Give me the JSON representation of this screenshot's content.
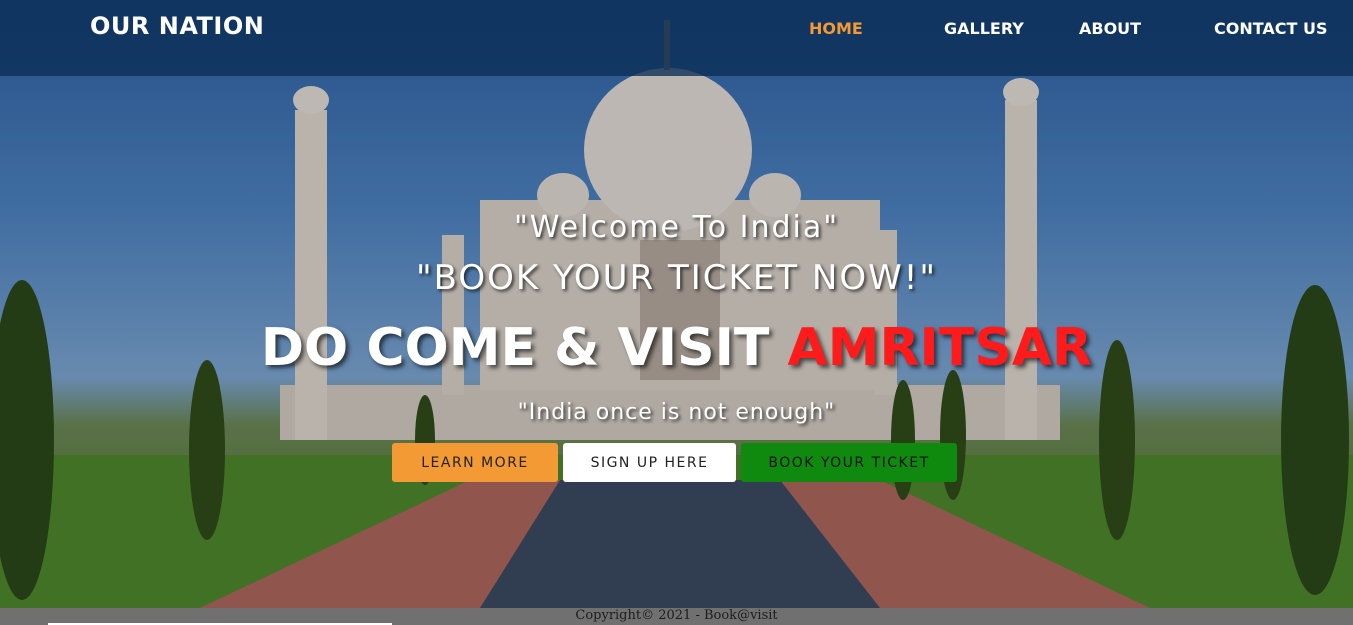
{
  "brand": {
    "name": "OUR NATION"
  },
  "nav": {
    "items": [
      {
        "label": "HOME",
        "active": true
      },
      {
        "label": "GALLERY",
        "active": false
      },
      {
        "label": "ABOUT",
        "active": false
      },
      {
        "label": "CONTACT US",
        "active": false
      }
    ]
  },
  "hero": {
    "welcome": "\"Welcome To India\"",
    "book_now": "\"BOOK YOUR TICKET NOW!\"",
    "headline_prefix": "DO COME & VISIT ",
    "headline_city": "AMRITSAR",
    "quote": "\"India once is not enough\"",
    "buttons": {
      "learn_more": "LEARN MORE",
      "sign_up": "SIGN UP HERE",
      "book_ticket": "BOOK YOUR TICKET"
    }
  },
  "footer": {
    "copyright": "Copyright© 2021 - Book@visit"
  },
  "colors": {
    "accent_orange": "#f39a35",
    "headline_red": "#ff1b1b",
    "book_green": "#0f8a0f",
    "navbar_bg": "#0a2d55"
  }
}
